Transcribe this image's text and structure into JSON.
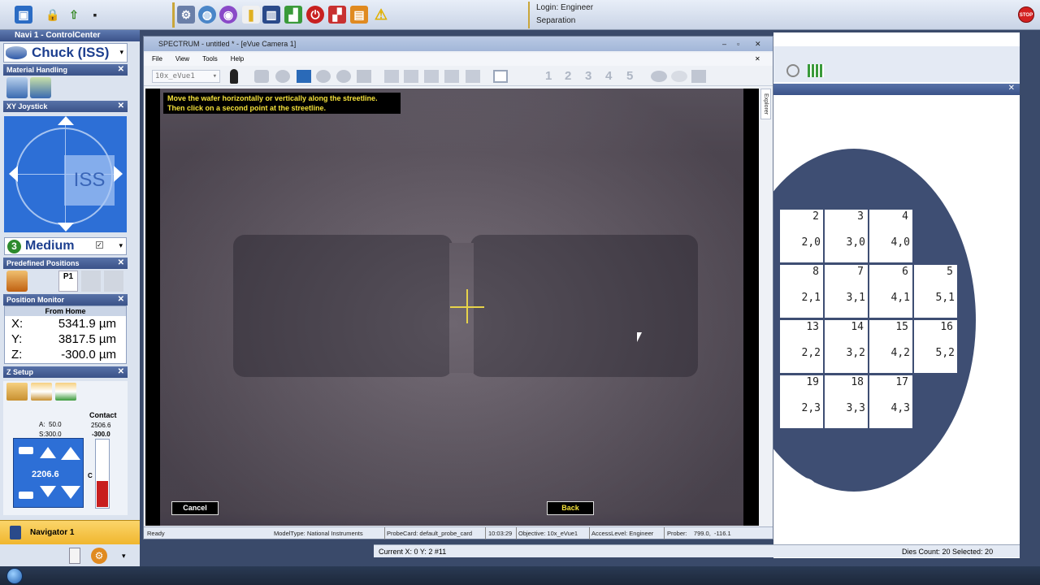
{
  "login": {
    "user": "Login: Engineer",
    "mode": "Separation"
  },
  "stop_label": "STOP",
  "navigator": {
    "title": "Navi 1 - ControlCenter",
    "chuck_label": "Chuck (ISS)",
    "panels": {
      "material_handling": "Material Handling",
      "xy_joystick": "XY Joystick",
      "predefined_positions": "Predefined Positions",
      "position_monitor": "Position Monitor",
      "z_setup": "Z Setup"
    },
    "joystick_label": "ISS",
    "speed": {
      "number": "3",
      "label": "Medium"
    },
    "predefined": {
      "p1_label": "P1"
    },
    "position_monitor": {
      "reference": "From Home",
      "rows": [
        {
          "axis": "X:",
          "value": "5341.9 µm"
        },
        {
          "axis": "Y:",
          "value": "3817.5 µm"
        },
        {
          "axis": "Z:",
          "value": "-300.0 µm"
        }
      ]
    },
    "z_setup": {
      "contact_label": "Contact",
      "contact_value": "2506.6",
      "contact_z": "-300.0",
      "a_label": "A:  50.0",
      "s_label": "S:300.0",
      "pad_value": "2206.6",
      "bar_letter": "C",
      "bar_level": 0.38
    },
    "footer_label": "Navigator 1"
  },
  "spectrum": {
    "title": "SPECTRUM - untitled * - [eVue Camera 1]",
    "menu": [
      "File",
      "View",
      "Tools",
      "Help"
    ],
    "objective_select": "10x_eVue1",
    "tool_numbers": [
      "1",
      "2",
      "3",
      "4",
      "5"
    ],
    "instruction_line1": "Move the wafer horizontally or vertically along the streetline.",
    "instruction_line2": "Then click on a second point at the streetline.",
    "cancel_label": "Cancel",
    "back_label": "Back",
    "explorer_tab": "Explorer",
    "status": {
      "state": "Ready",
      "model": "ModelType: National Instruments",
      "probecard": "ProbeCard: default_probe_card",
      "time": "10:03:29",
      "objective": "Objective: 10x_eVue1",
      "access": "AccessLevel: Engineer",
      "prober": "Prober:    799.0,  -116.1"
    }
  },
  "wafer_map": {
    "dies": [
      {
        "n": "2",
        "c": "2,0"
      },
      {
        "n": "3",
        "c": "3,0"
      },
      {
        "n": "4",
        "c": "4,0"
      },
      {
        "n": "8",
        "c": "2,1"
      },
      {
        "n": "7",
        "c": "3,1"
      },
      {
        "n": "6",
        "c": "4,1"
      },
      {
        "n": "5",
        "c": "5,1"
      },
      {
        "n": "13",
        "c": "2,2"
      },
      {
        "n": "14",
        "c": "3,2"
      },
      {
        "n": "15",
        "c": "4,2"
      },
      {
        "n": "16",
        "c": "5,2"
      },
      {
        "n": "19",
        "c": "2,3"
      },
      {
        "n": "18",
        "c": "3,3"
      },
      {
        "n": "17",
        "c": "4,3"
      }
    ],
    "status_current": "Current X: 0 Y: 2 #11",
    "status_dies": "Dies Count: 20 Selected: 20"
  }
}
